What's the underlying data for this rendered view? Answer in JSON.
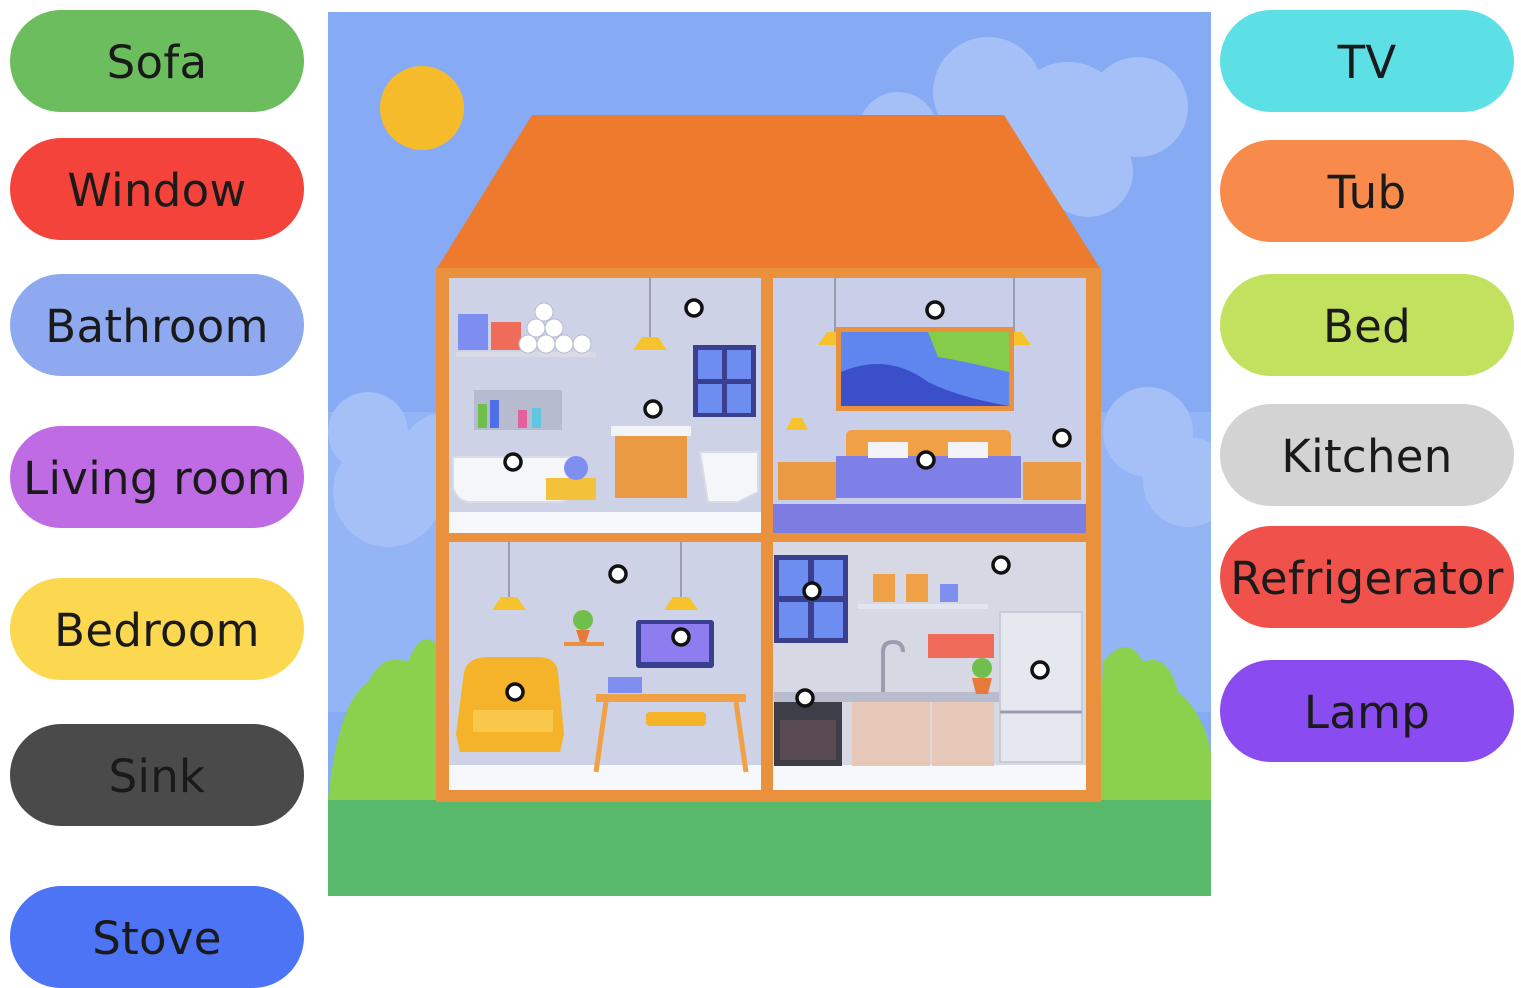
{
  "left_labels": [
    {
      "text": "Sofa",
      "color": "#6cbd5e"
    },
    {
      "text": "Window",
      "color": "#f4433a"
    },
    {
      "text": "Bathroom",
      "color": "#8ea9ef"
    },
    {
      "text": "Living room",
      "color": "#bf6be3"
    },
    {
      "text": "Bedroom",
      "color": "#fbd84f"
    },
    {
      "text": "Sink",
      "color": "#4a4a4a"
    },
    {
      "text": "Stove",
      "color": "#4d74f5"
    }
  ],
  "right_labels": [
    {
      "text": "TV",
      "color": "#5de0e5"
    },
    {
      "text": "Tub",
      "color": "#f88b4c"
    },
    {
      "text": "Bed",
      "color": "#c2e15f"
    },
    {
      "text": "Kitchen",
      "color": "#d3d3d3"
    },
    {
      "text": "Refrigerator",
      "color": "#f0514b"
    },
    {
      "text": "Lamp",
      "color": "#8a4cf0"
    }
  ],
  "scene": {
    "sky_color": "#86aaf4",
    "roof_color": "#ee7a2e",
    "grass_color": "#59b96b",
    "wall_color": "#e9913c",
    "hotspot_count": 14
  }
}
